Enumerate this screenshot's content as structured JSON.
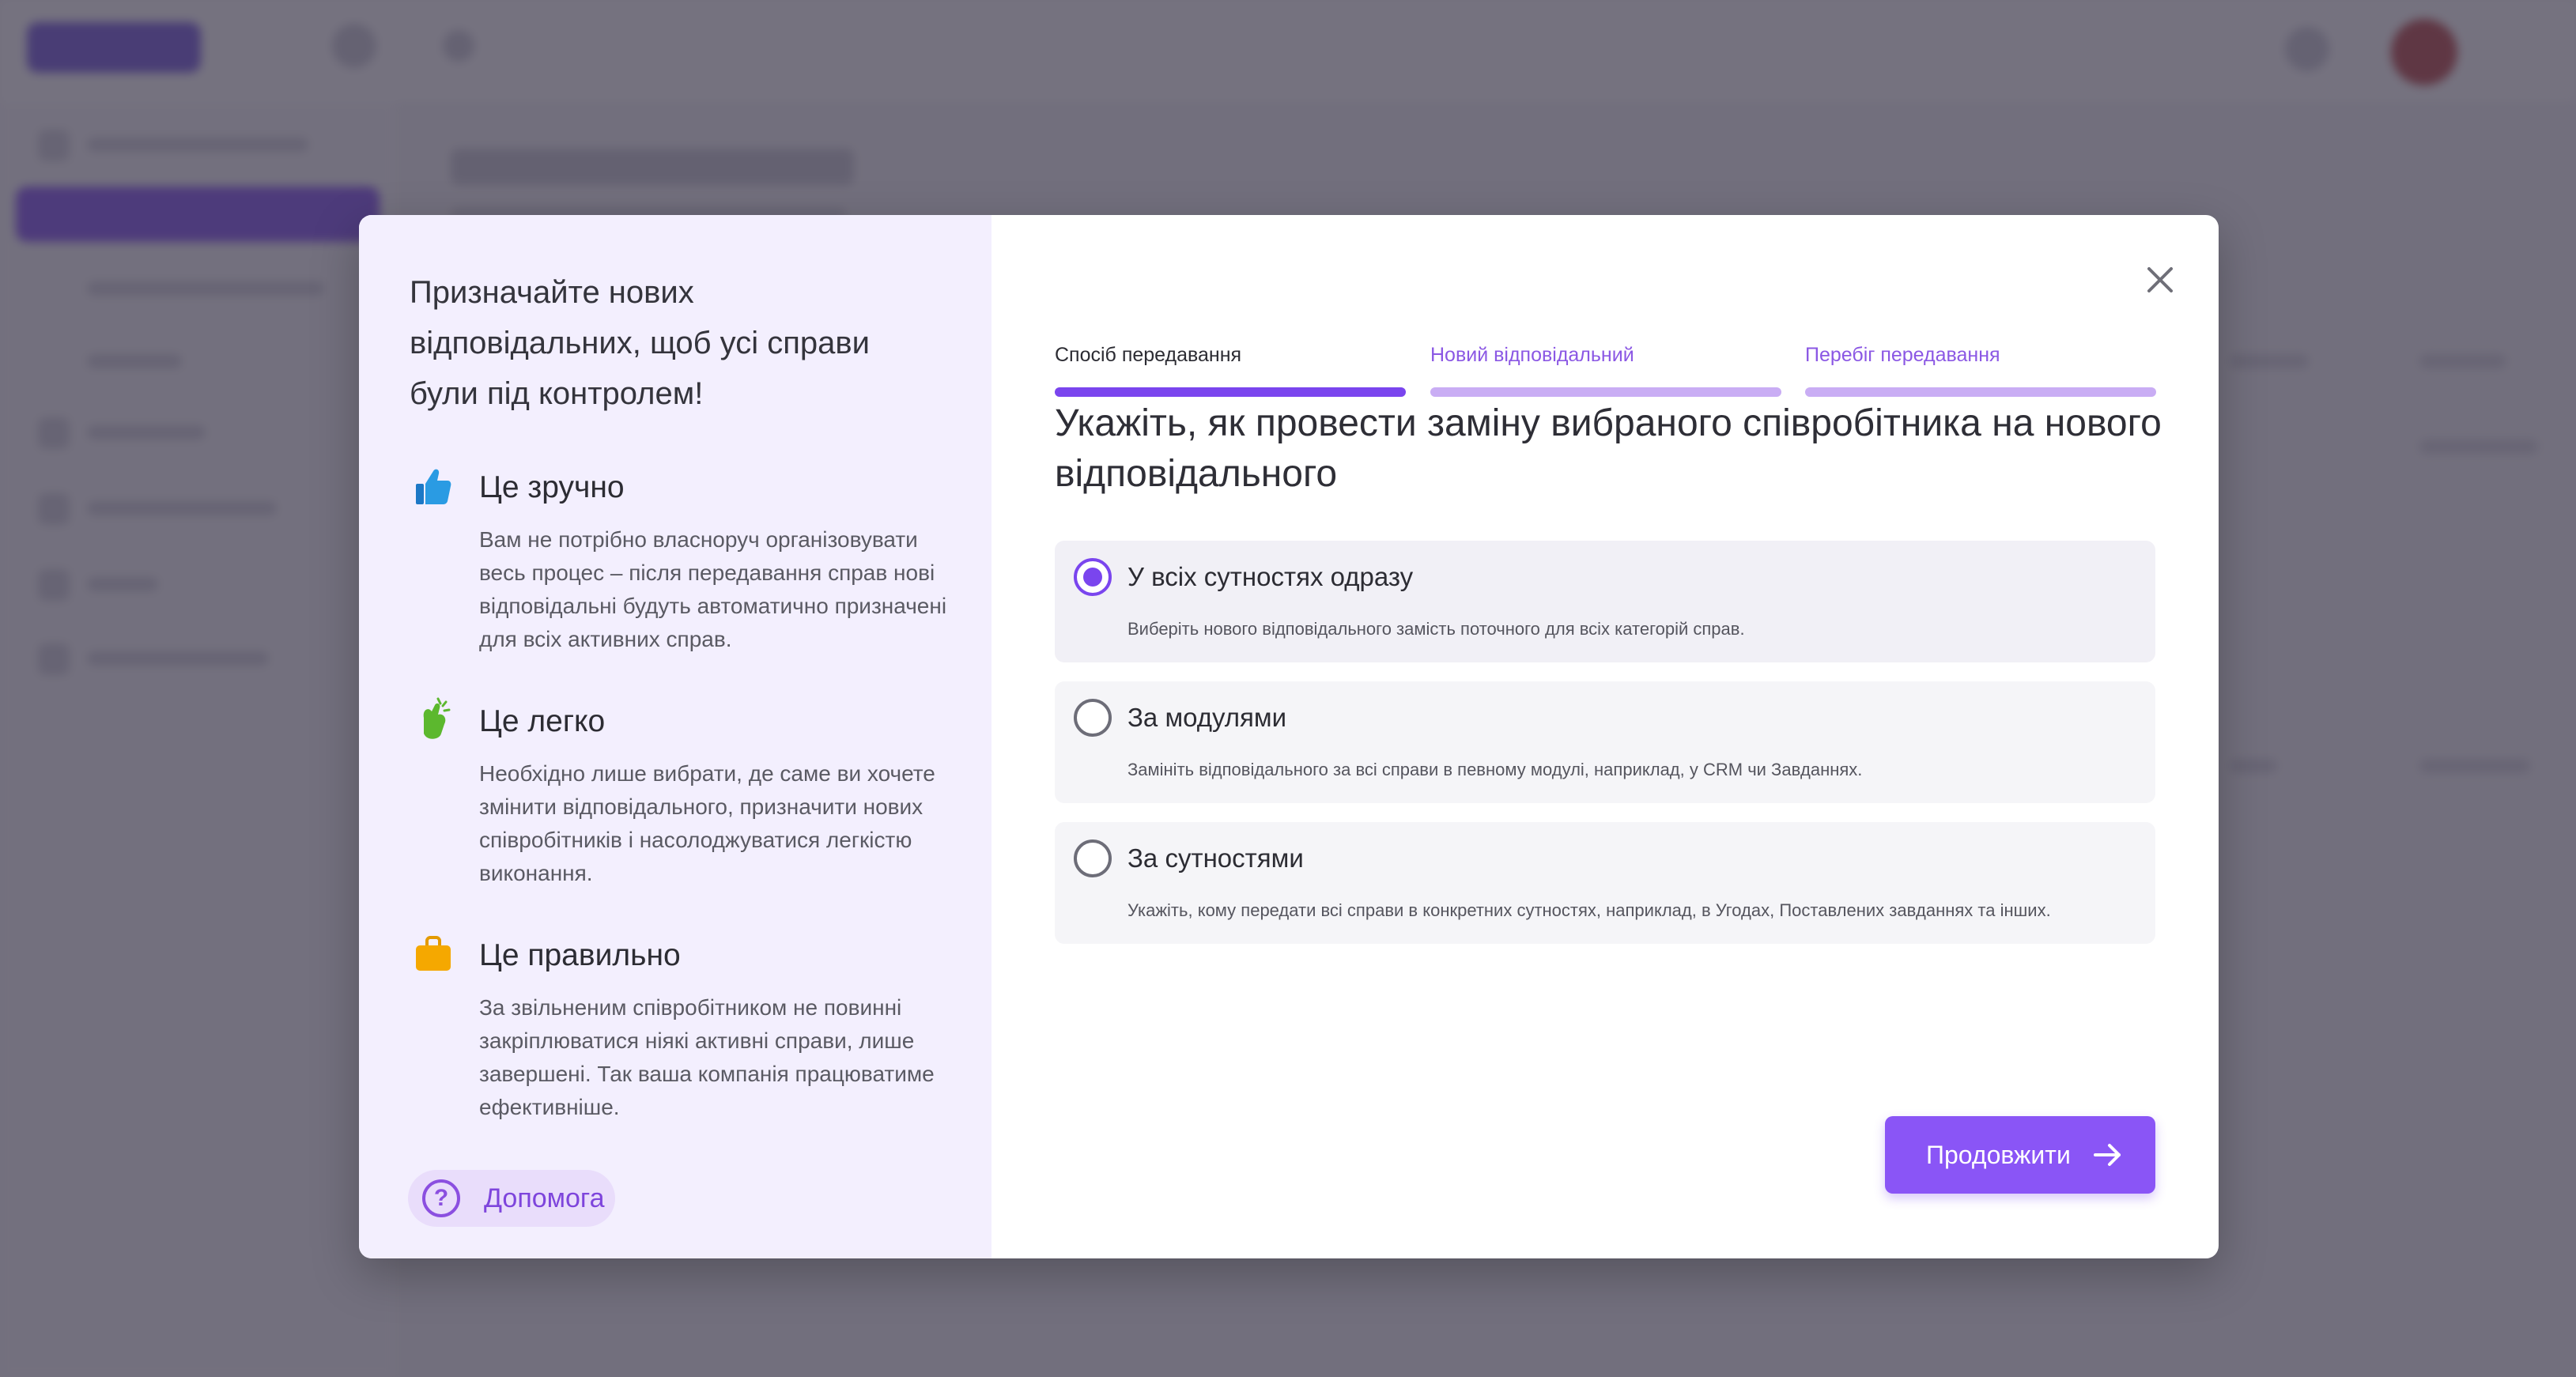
{
  "promo": {
    "title": "Призначайте нових відповідальних, щоб усі справи були під контролем!",
    "features": [
      {
        "icon": "thumbs-up-icon",
        "heading": "Це зручно",
        "text": "Вам не потрібно власноруч організовувати весь процес – після передавання справ нові відповідальні будуть автоматично призначені для всіх активних справ."
      },
      {
        "icon": "snap-fingers-icon",
        "heading": "Це легко",
        "text": "Необхідно лише вибрати, де саме ви хочете змінити відповідального, призначити нових співробітників і насолоджуватися легкістю виконання."
      },
      {
        "icon": "briefcase-icon",
        "heading": "Це правильно",
        "text": "За звільненим співробітником не повинні закріплюватися ніякі активні справи, лише завершені. Так ваша компанія працюватиме ефективніше."
      }
    ],
    "help_label": "Допомога"
  },
  "steps": [
    {
      "label": "Спосіб передавання",
      "state": "active"
    },
    {
      "label": "Новий відповідальний",
      "state": "upcoming"
    },
    {
      "label": "Перебіг передавання",
      "state": "upcoming"
    }
  ],
  "main": {
    "title": "Укажіть, як провести заміну вибраного співробітника на нового відповідального",
    "options": [
      {
        "title": "У всіх сутностях одразу",
        "description": "Виберіть нового відповідального замість поточного для всіх категорій справ.",
        "selected": true
      },
      {
        "title": "За модулями",
        "description": "Замініть відповідального за всі справи в певному модулі, наприклад, у CRM чи Завданнях.",
        "selected": false
      },
      {
        "title": "За сутностями",
        "description": "Укажіть, кому передати всі справи в конкретних сутностях, наприклад, в Угодах, Поставлених завданнях та інших.",
        "selected": false
      }
    ],
    "continue_label": "Продовжити"
  },
  "colors": {
    "accent": "#7a45ee",
    "accent_light": "#c9adf4",
    "promo_bg": "#f3effe",
    "overlay": "#3a3648"
  }
}
